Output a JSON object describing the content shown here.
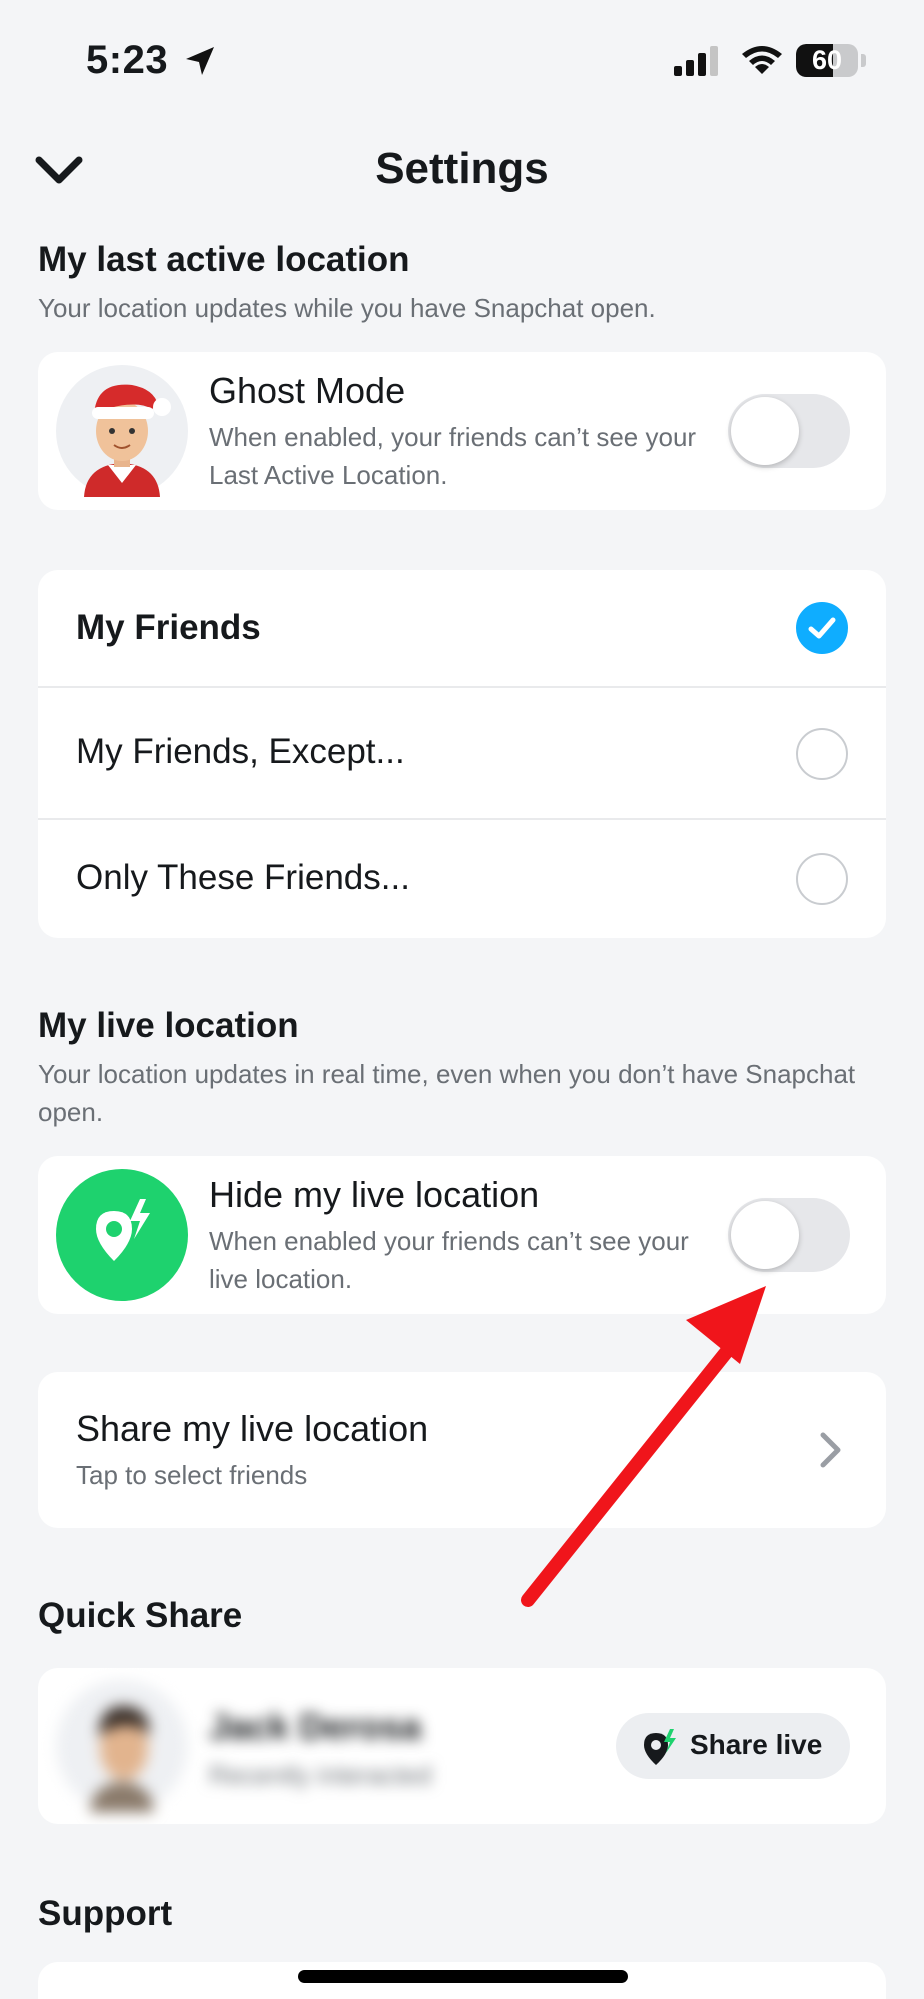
{
  "status_bar": {
    "time": "5:23",
    "battery_percent": 60,
    "battery_text": "60"
  },
  "header": {
    "title": "Settings",
    "back_icon": "chevron-down-icon"
  },
  "last_active": {
    "title": "My last active location",
    "subtitle": "Your location updates while you have Snapchat open.",
    "ghost_mode": {
      "title": "Ghost Mode",
      "description": "When enabled, your friends can’t see your Last Active Location.",
      "enabled": false
    },
    "audience_options": [
      {
        "label": "My Friends",
        "selected": true
      },
      {
        "label": "My Friends, Except...",
        "selected": false
      },
      {
        "label": "Only These Friends...",
        "selected": false
      }
    ]
  },
  "live_location": {
    "title": "My live location",
    "subtitle": "Your location updates in real time, even when you don’t have Snapchat open.",
    "hide": {
      "title": "Hide my live location",
      "description": "When enabled your friends can’t see your live location.",
      "enabled": false
    },
    "share": {
      "title": "Share my live location",
      "subtitle": "Tap to select friends"
    }
  },
  "quick_share": {
    "title": "Quick Share",
    "contact": {
      "name": "Jack Derosa",
      "status": "Recently interacted"
    },
    "button_label": "Share live"
  },
  "support": {
    "title": "Support"
  },
  "colors": {
    "accent_blue": "#0fadff",
    "live_green": "#1ed26e",
    "annotation_red": "#f0151b",
    "background": "#f4f5f7"
  }
}
